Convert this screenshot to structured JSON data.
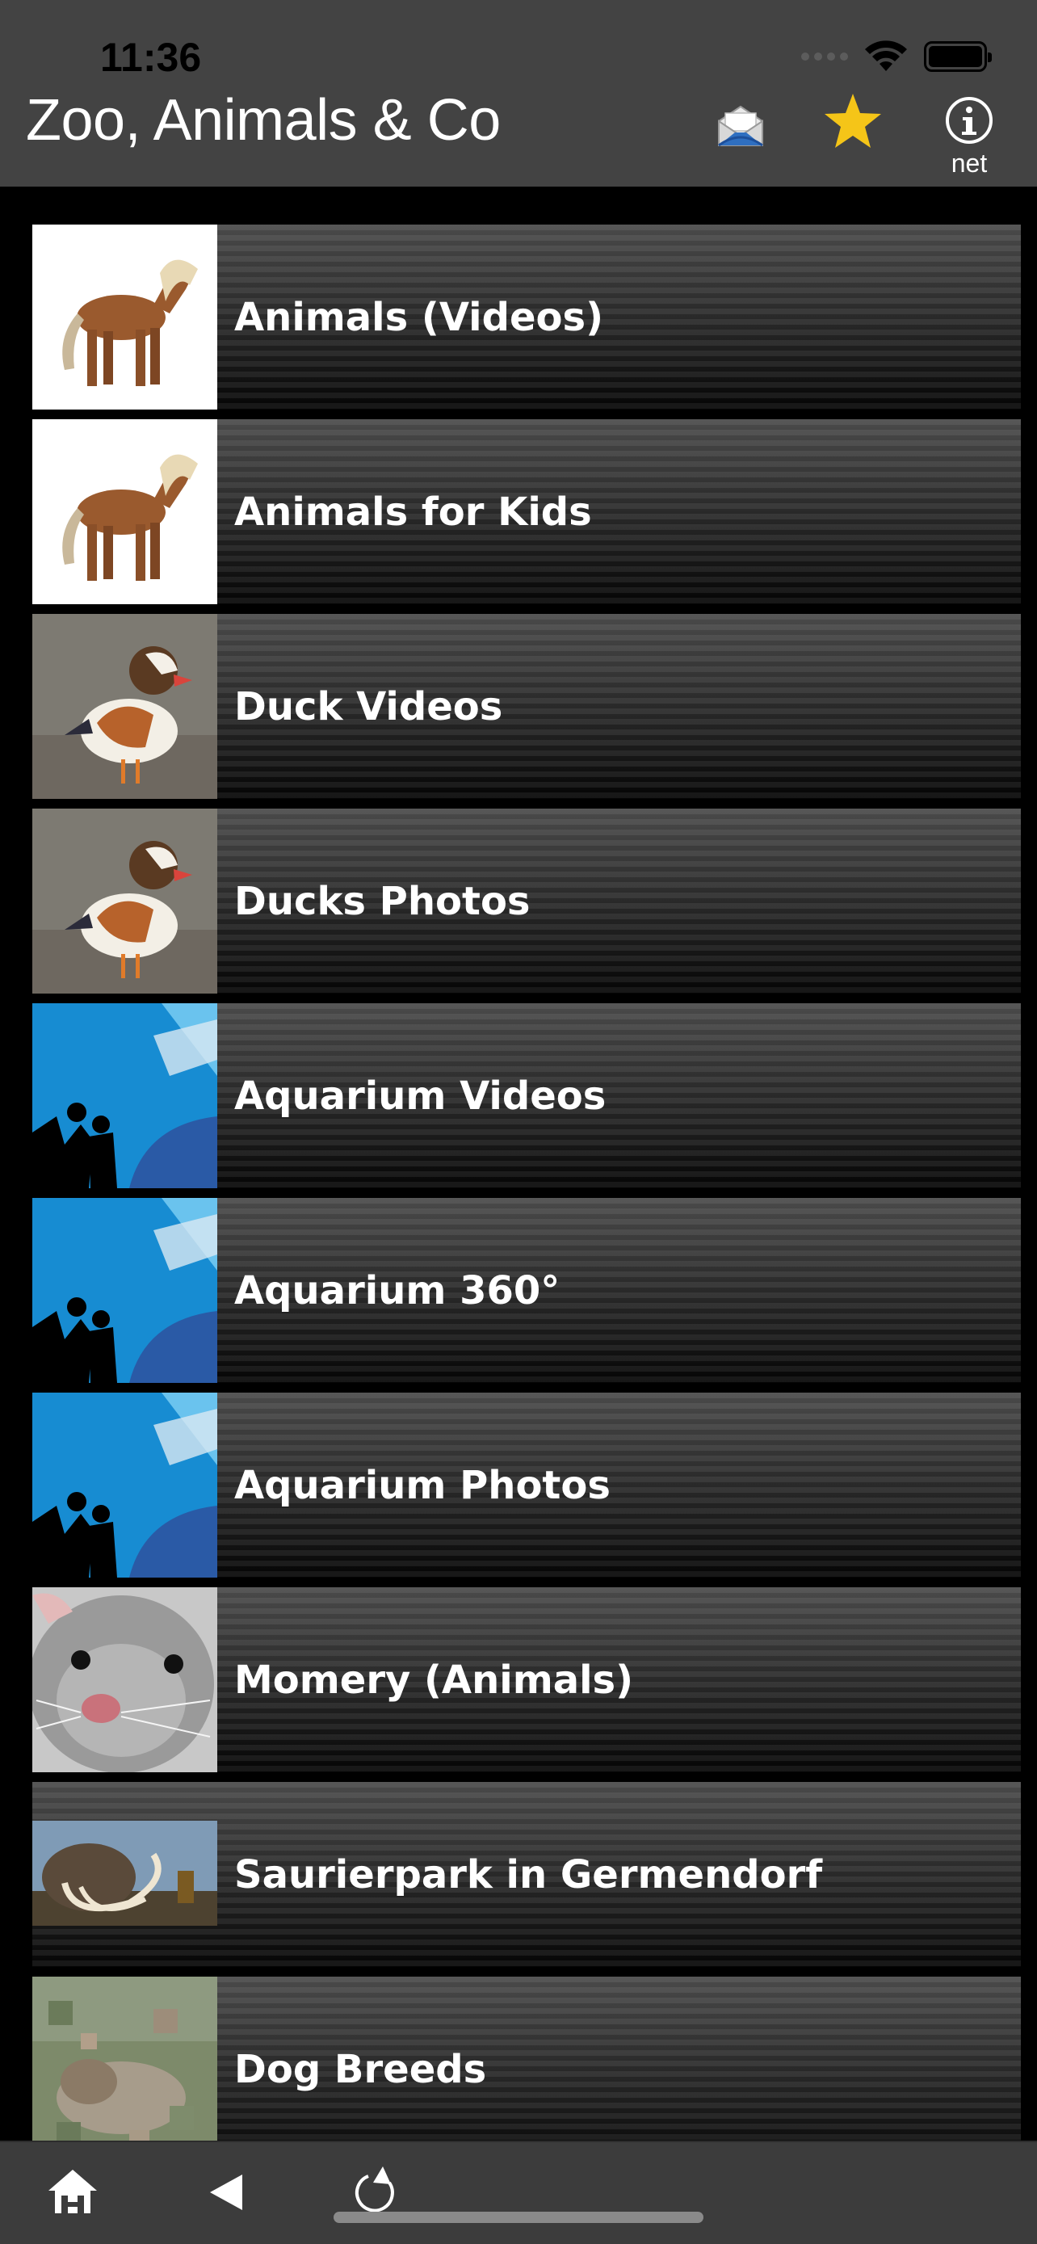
{
  "status_bar": {
    "time": "11:36"
  },
  "header": {
    "title": "Zoo, Animals & Co",
    "info_caption": "net",
    "icons": {
      "mail": "mail-icon",
      "favorites": "star-icon",
      "info": "info-icon"
    },
    "accent_star_color": "#F5C518"
  },
  "list": {
    "items": [
      {
        "label": "Animals (Videos)",
        "thumbnail": "pony"
      },
      {
        "label": "Animals for Kids",
        "thumbnail": "pony"
      },
      {
        "label": "Duck Videos",
        "thumbnail": "mandarin-duck"
      },
      {
        "label": "Ducks Photos",
        "thumbnail": "mandarin-duck"
      },
      {
        "label": "Aquarium Videos",
        "thumbnail": "aquarium"
      },
      {
        "label": "Aquarium 360°",
        "thumbnail": "aquarium"
      },
      {
        "label": "Aquarium Photos",
        "thumbnail": "aquarium"
      },
      {
        "label": "Momery (Animals)",
        "thumbnail": "mouse"
      },
      {
        "label": "Saurierpark in Germendorf",
        "thumbnail": "mammoth"
      },
      {
        "label": "Dog Breeds",
        "thumbnail": "dog-mosaic"
      }
    ]
  },
  "toolbar": {
    "icons": {
      "home": "home-icon",
      "back": "back-arrow-icon",
      "refresh": "refresh-icon"
    }
  },
  "colors": {
    "header_bg": "#434343",
    "list_bg": "#000000",
    "toolbar_bg": "#3C3C3C"
  }
}
